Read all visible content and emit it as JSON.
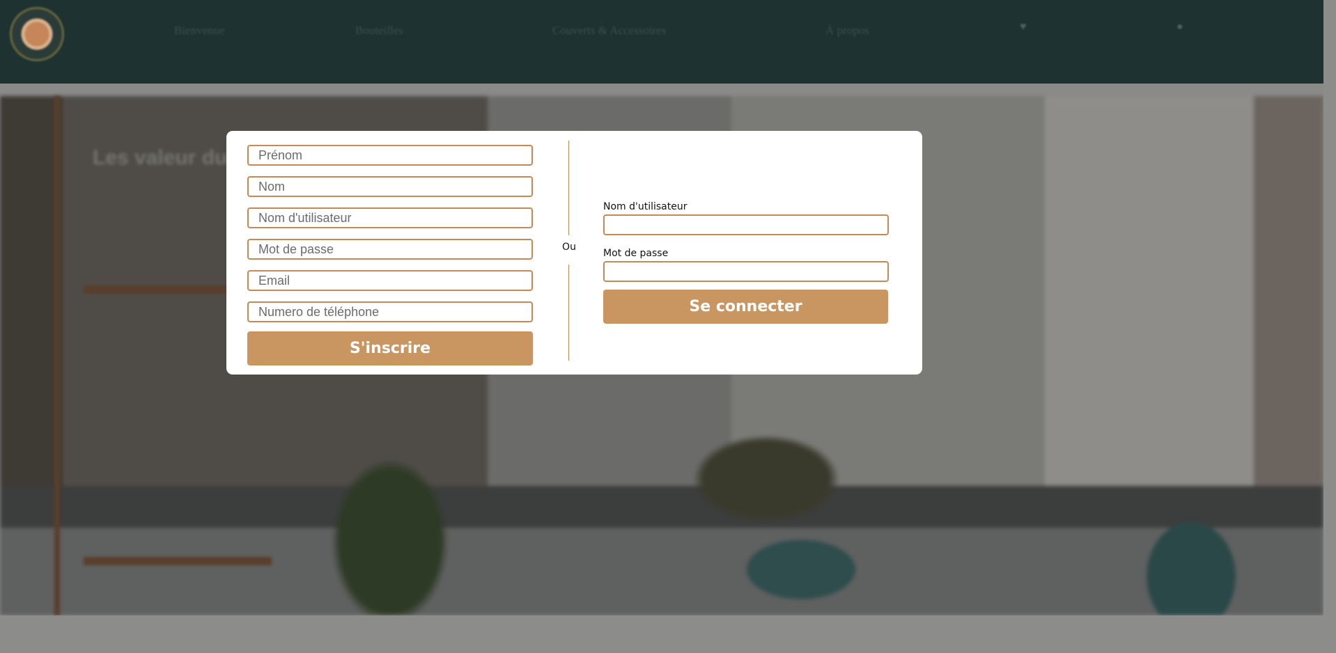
{
  "background_site": {
    "nav": [
      "Bienvenue",
      "Bouteilles",
      "Couverts & Accessoires",
      "À propos"
    ],
    "icons": [
      "heart-icon",
      "user-icon"
    ],
    "hero": {
      "title": "Les valeur du"
    }
  },
  "modal": {
    "signup": {
      "first_name_placeholder": "Prénom",
      "last_name_placeholder": "Nom",
      "username_placeholder": "Nom d'utilisateur",
      "password_placeholder": "Mot de passe",
      "email_placeholder": "Email",
      "phone_placeholder": "Numero de téléphone",
      "submit_label": "S'inscrire"
    },
    "divider_text": "Ou",
    "login": {
      "username_label": "Nom d'utilisateur",
      "username_value": "",
      "password_label": "Mot de passe",
      "password_value": "",
      "submit_label": "Se connecter"
    }
  },
  "colors": {
    "header_bg": "#1d3231",
    "accent": "#c99662",
    "input_border": "#c48a55"
  }
}
